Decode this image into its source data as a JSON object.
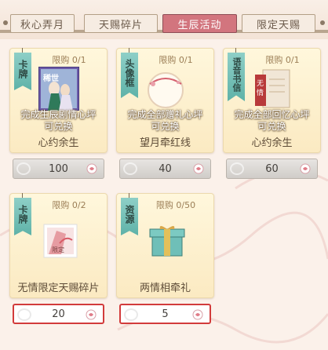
{
  "tabs": [
    {
      "label": "秋心弄月",
      "active": false
    },
    {
      "label": "天赐碎片",
      "active": false
    },
    {
      "label": "生辰活动",
      "active": true
    },
    {
      "label": "限定天赐",
      "active": false
    }
  ],
  "cards": [
    {
      "ribbon": "卡牌",
      "limit": "限购 0/1",
      "desc_line1": "完成生辰剧情心坪",
      "desc_line2": "可兑换",
      "name": "心约余生",
      "price": "100",
      "price_style": "gray",
      "image": "card-art",
      "image_text": "稀世"
    },
    {
      "ribbon": "头像框",
      "limit": "限购 0/1",
      "desc_line1": "完成全部赠礼心坪",
      "desc_line2": "可兑换",
      "name": "望月牵红线",
      "price": "40",
      "price_style": "gray",
      "image": "avatar-frame"
    },
    {
      "ribbon": "语音书信",
      "limit": "限购 0/1",
      "desc_line1": "完成全部回忆心坪",
      "desc_line2": "可兑换",
      "name": "心约余生",
      "price": "60",
      "price_style": "gray",
      "image": "letter",
      "image_text": "无情"
    },
    {
      "ribbon": "卡牌",
      "limit": "限购 0/2",
      "desc_line1": "",
      "desc_line2": "",
      "name": "无情限定天赐碎片",
      "price": "20",
      "price_style": "red",
      "image": "card-fragment",
      "image_text": "限定"
    },
    {
      "ribbon": "资源",
      "limit": "限购 0/50",
      "desc_line1": "",
      "desc_line2": "",
      "name": "两情相牵礼",
      "price": "5",
      "price_style": "red",
      "image": "gift-box"
    }
  ],
  "colors": {
    "active_tab": "#d2757e",
    "ribbon": "#6fbdb3",
    "highlight_border": "#d23b3b"
  }
}
